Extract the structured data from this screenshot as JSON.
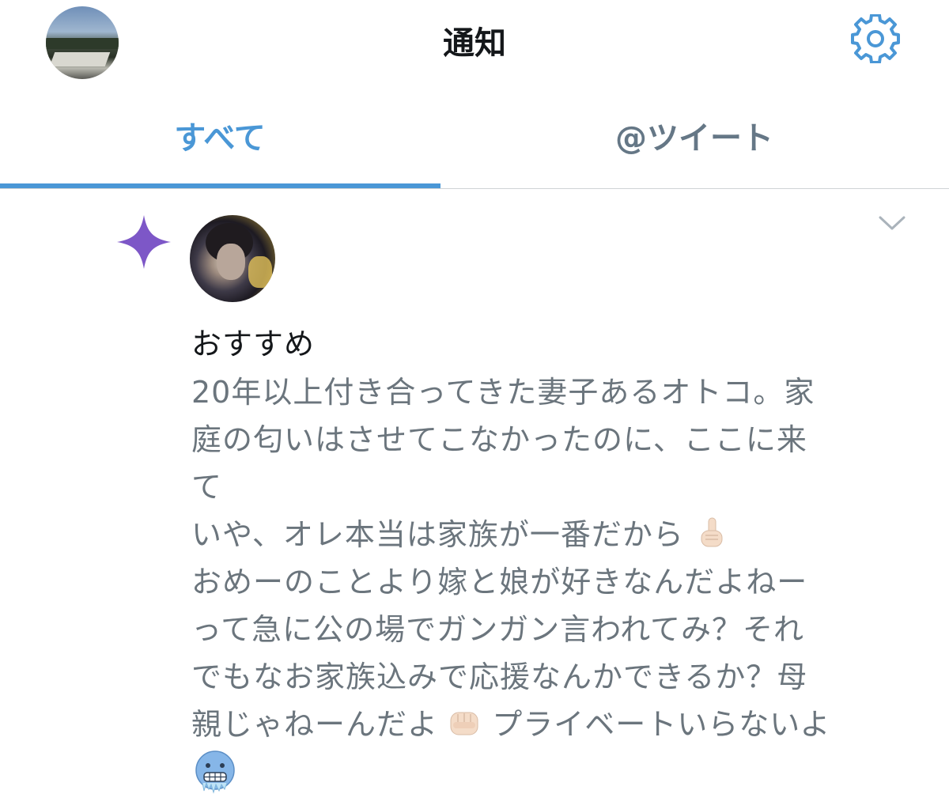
{
  "header": {
    "title": "通知",
    "profile_avatar_icon": "profile-avatar-icon",
    "settings_icon": "gear-icon"
  },
  "tabs": [
    {
      "label": "すべて",
      "active": true
    },
    {
      "label": "@ツイート",
      "active": false
    }
  ],
  "colors": {
    "accent": "#4a97d6",
    "inactive_tab": "#657786",
    "sparkle": "#7d57c7",
    "body_text": "#6b757d"
  },
  "notification": {
    "type_icon": "sparkle-icon",
    "menu_icon": "chevron-down-icon",
    "label": "おすすめ",
    "lines": [
      "20年以上付き合ってきた妻子あるオトコ。家",
      "庭の匂いはさせてこなかったのに、ここに来",
      "て",
      "いや、オレ本当は家族が一番だから",
      "おめーのことより嫁と娘が好きなんだよねー",
      "って急に公の場でガンガン言われてみ？それ",
      "でもなお家族込みで応援なんかできるか？母",
      "親じゃねーんだよ",
      "プライベートいらないよ"
    ],
    "emojis": [
      "pointing-up-emoji",
      "fist-emoji",
      "cold-face-emoji"
    ]
  }
}
